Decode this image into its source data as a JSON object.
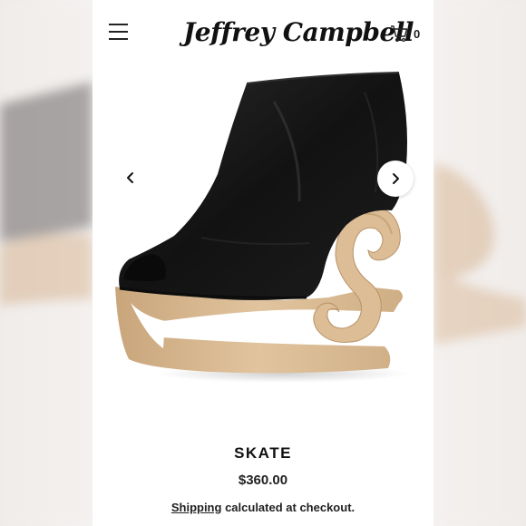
{
  "header": {
    "brand": "Jeffrey Campbell",
    "cart_count": "0"
  },
  "gallery": {
    "prev_icon": "chevron-left-icon",
    "next_icon": "chevron-right-icon"
  },
  "product": {
    "title": "SKATE",
    "price": "$360.00",
    "shipping_link": "Shipping",
    "shipping_rest": "calculated at checkout."
  },
  "colors": {
    "leather": "#141414",
    "wood": "#d9b88f",
    "wood_dark": "#b99368",
    "text": "#111111"
  }
}
